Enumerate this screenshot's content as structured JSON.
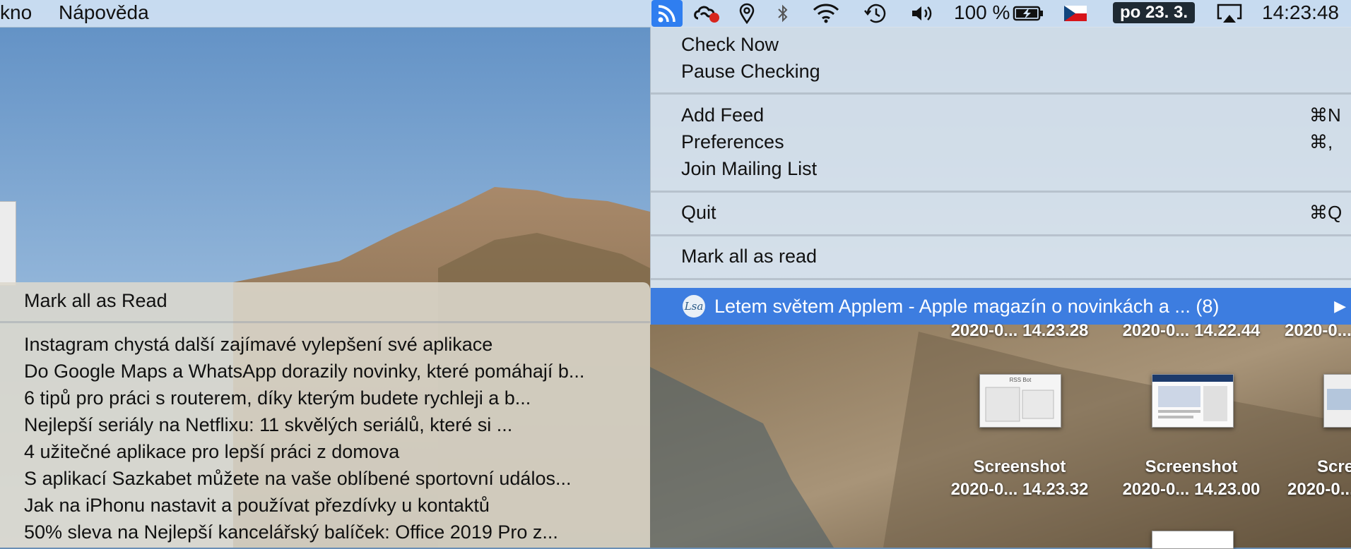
{
  "app_menu": {
    "items": [
      "kno",
      "Nápověda"
    ]
  },
  "status_bar": {
    "icons": [
      "rss-icon",
      "creative-cloud-icon",
      "location-icon",
      "bluetooth-icon",
      "wifi-icon",
      "time-machine-icon",
      "volume-icon"
    ],
    "battery_percent": "100 %",
    "date": "po 23. 3.",
    "time": "14:23:48"
  },
  "rss_menu": {
    "check_now": "Check Now",
    "pause_checking": "Pause Checking",
    "add_feed": "Add Feed",
    "add_feed_shortcut": "⌘N",
    "preferences": "Preferences",
    "preferences_shortcut": "⌘,",
    "join_mailing_list": "Join Mailing List",
    "quit": "Quit",
    "quit_shortcut": "⌘Q",
    "mark_all_as_read": "Mark all as read",
    "feed": {
      "icon_text": "Lsa",
      "title": "Letem světem Applem - Apple magazín o novinkách a ... (8)",
      "arrow": "▶"
    }
  },
  "submenu": {
    "mark_all_as_read": "Mark all as Read",
    "articles": [
      "Instagram chystá další zajímavé vylepšení své aplikace",
      "Do Google Maps a WhatsApp dorazily novinky, které pomáhají b...",
      "6 tipů pro práci s routerem, díky kterým budete rychleji a b...",
      "Nejlepší seriály na Netflixu: 11 skvělých seriálů, které si ...",
      "4 užitečné aplikace pro lepší práci z domova",
      "S aplikací Sazkabet můžete na vaše oblíbené sportovní událos...",
      "Jak na iPhonu nastavit a používat přezdívky u kontaktů",
      "50% sleva na Nejlepší kancelářský balíček: Office 2019 Pro z..."
    ]
  },
  "desktop": {
    "top_labels": [
      "2020-0... 14.23.28",
      "2020-0... 14.22.44",
      "2020-0..."
    ],
    "files": [
      {
        "name": "Screenshot",
        "date": "2020-0... 14.23.32"
      },
      {
        "name": "Screenshot",
        "date": "2020-0... 14.23.00"
      },
      {
        "name": "Scre",
        "date": "2020-0..."
      }
    ],
    "thumb_title": "RSS Bot"
  }
}
